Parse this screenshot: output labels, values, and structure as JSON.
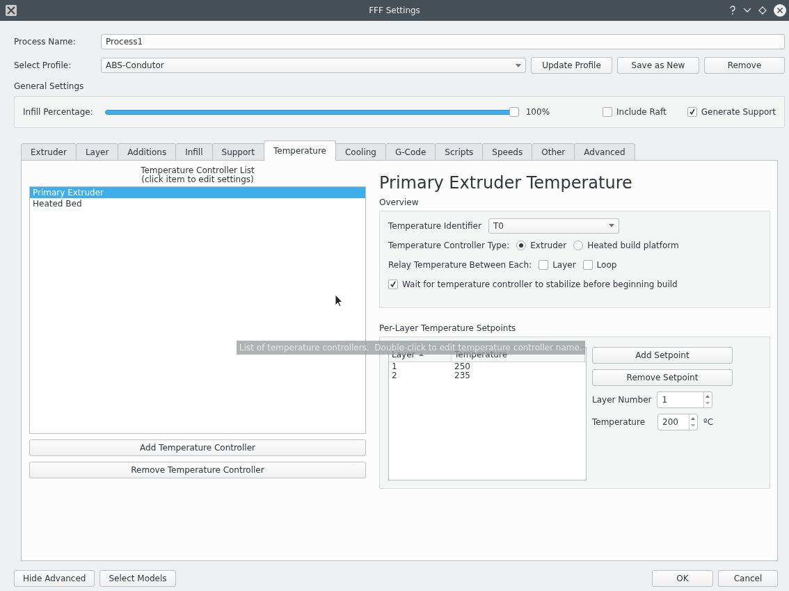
{
  "window": {
    "title": "FFF Settings"
  },
  "process_name": {
    "label": "Process Name:",
    "value": "Process1"
  },
  "select_profile": {
    "label": "Select Profile:",
    "value": "ABS-Condutor",
    "buttons": [
      "Update Profile",
      "Save as New",
      "Remove"
    ]
  },
  "general_settings": {
    "title": "General Settings",
    "infill": {
      "label": "Infill Percentage:",
      "level": 1,
      "reading": "100%"
    },
    "checkboxes": [
      {
        "label": "Include Raft",
        "checked": false
      },
      {
        "label": "Generate Support",
        "checked": true
      }
    ]
  },
  "tabs": [
    {
      "label": "Extruder",
      "selected": false
    },
    {
      "label": "Layer",
      "selected": false
    },
    {
      "label": "Additions",
      "selected": false
    },
    {
      "label": "Infill",
      "selected": false
    },
    {
      "label": "Support",
      "selected": false
    },
    {
      "label": "Temperature",
      "selected": true
    },
    {
      "label": "Cooling",
      "selected": false
    },
    {
      "label": "G-Code",
      "selected": false
    },
    {
      "label": "Scripts",
      "selected": false
    },
    {
      "label": "Speeds",
      "selected": false
    },
    {
      "label": "Other",
      "selected": false
    },
    {
      "label": "Advanced",
      "selected": false
    }
  ],
  "controller_list": {
    "heading": "Temperature Controller List",
    "subheading": "(click item to edit settings)",
    "items": [
      {
        "label": "Primary Extruder",
        "selected": true
      },
      {
        "label": "Heated Bed",
        "selected": false
      }
    ],
    "buttons": [
      "Add Temperature Controller",
      "Remove Temperature Controller"
    ]
  },
  "editor": {
    "title": "Primary Extruder Temperature",
    "overview": {
      "title": "Overview",
      "identifier": {
        "label": "Temperature Identifier",
        "value": "T0"
      },
      "controller_type": {
        "label": "Temperature Controller Type:",
        "options": [
          {
            "label": "Extruder",
            "selected": true
          },
          {
            "label": "Heated build platform",
            "selected": false
          }
        ]
      },
      "relay": {
        "label": "Relay Temperature Between Each:",
        "options": [
          {
            "label": "Layer",
            "checked": false
          },
          {
            "label": "Loop",
            "checked": false
          }
        ]
      },
      "wait": {
        "label": "Wait for temperature controller to stabilize before beginning build",
        "checked": true
      }
    },
    "setpoints": {
      "title": "Per-Layer Temperature Setpoints",
      "columns": [
        "Layer",
        "Temperature"
      ],
      "rows": [
        [
          "1",
          "250"
        ],
        [
          "2",
          "235"
        ]
      ],
      "buttons": [
        "Add Setpoint",
        "Remove Setpoint"
      ],
      "layer_number": {
        "label": "Layer Number",
        "value": "1"
      },
      "temperature": {
        "label": "Temperature",
        "value": "200",
        "unit": "ºC"
      }
    }
  },
  "tooltip": "List of temperature controllers.  Double-click to edit temperature controller name.",
  "footer": {
    "left_buttons": [
      "Hide Advanced",
      "Select Models"
    ],
    "right_buttons": [
      "OK",
      "Cancel"
    ]
  }
}
